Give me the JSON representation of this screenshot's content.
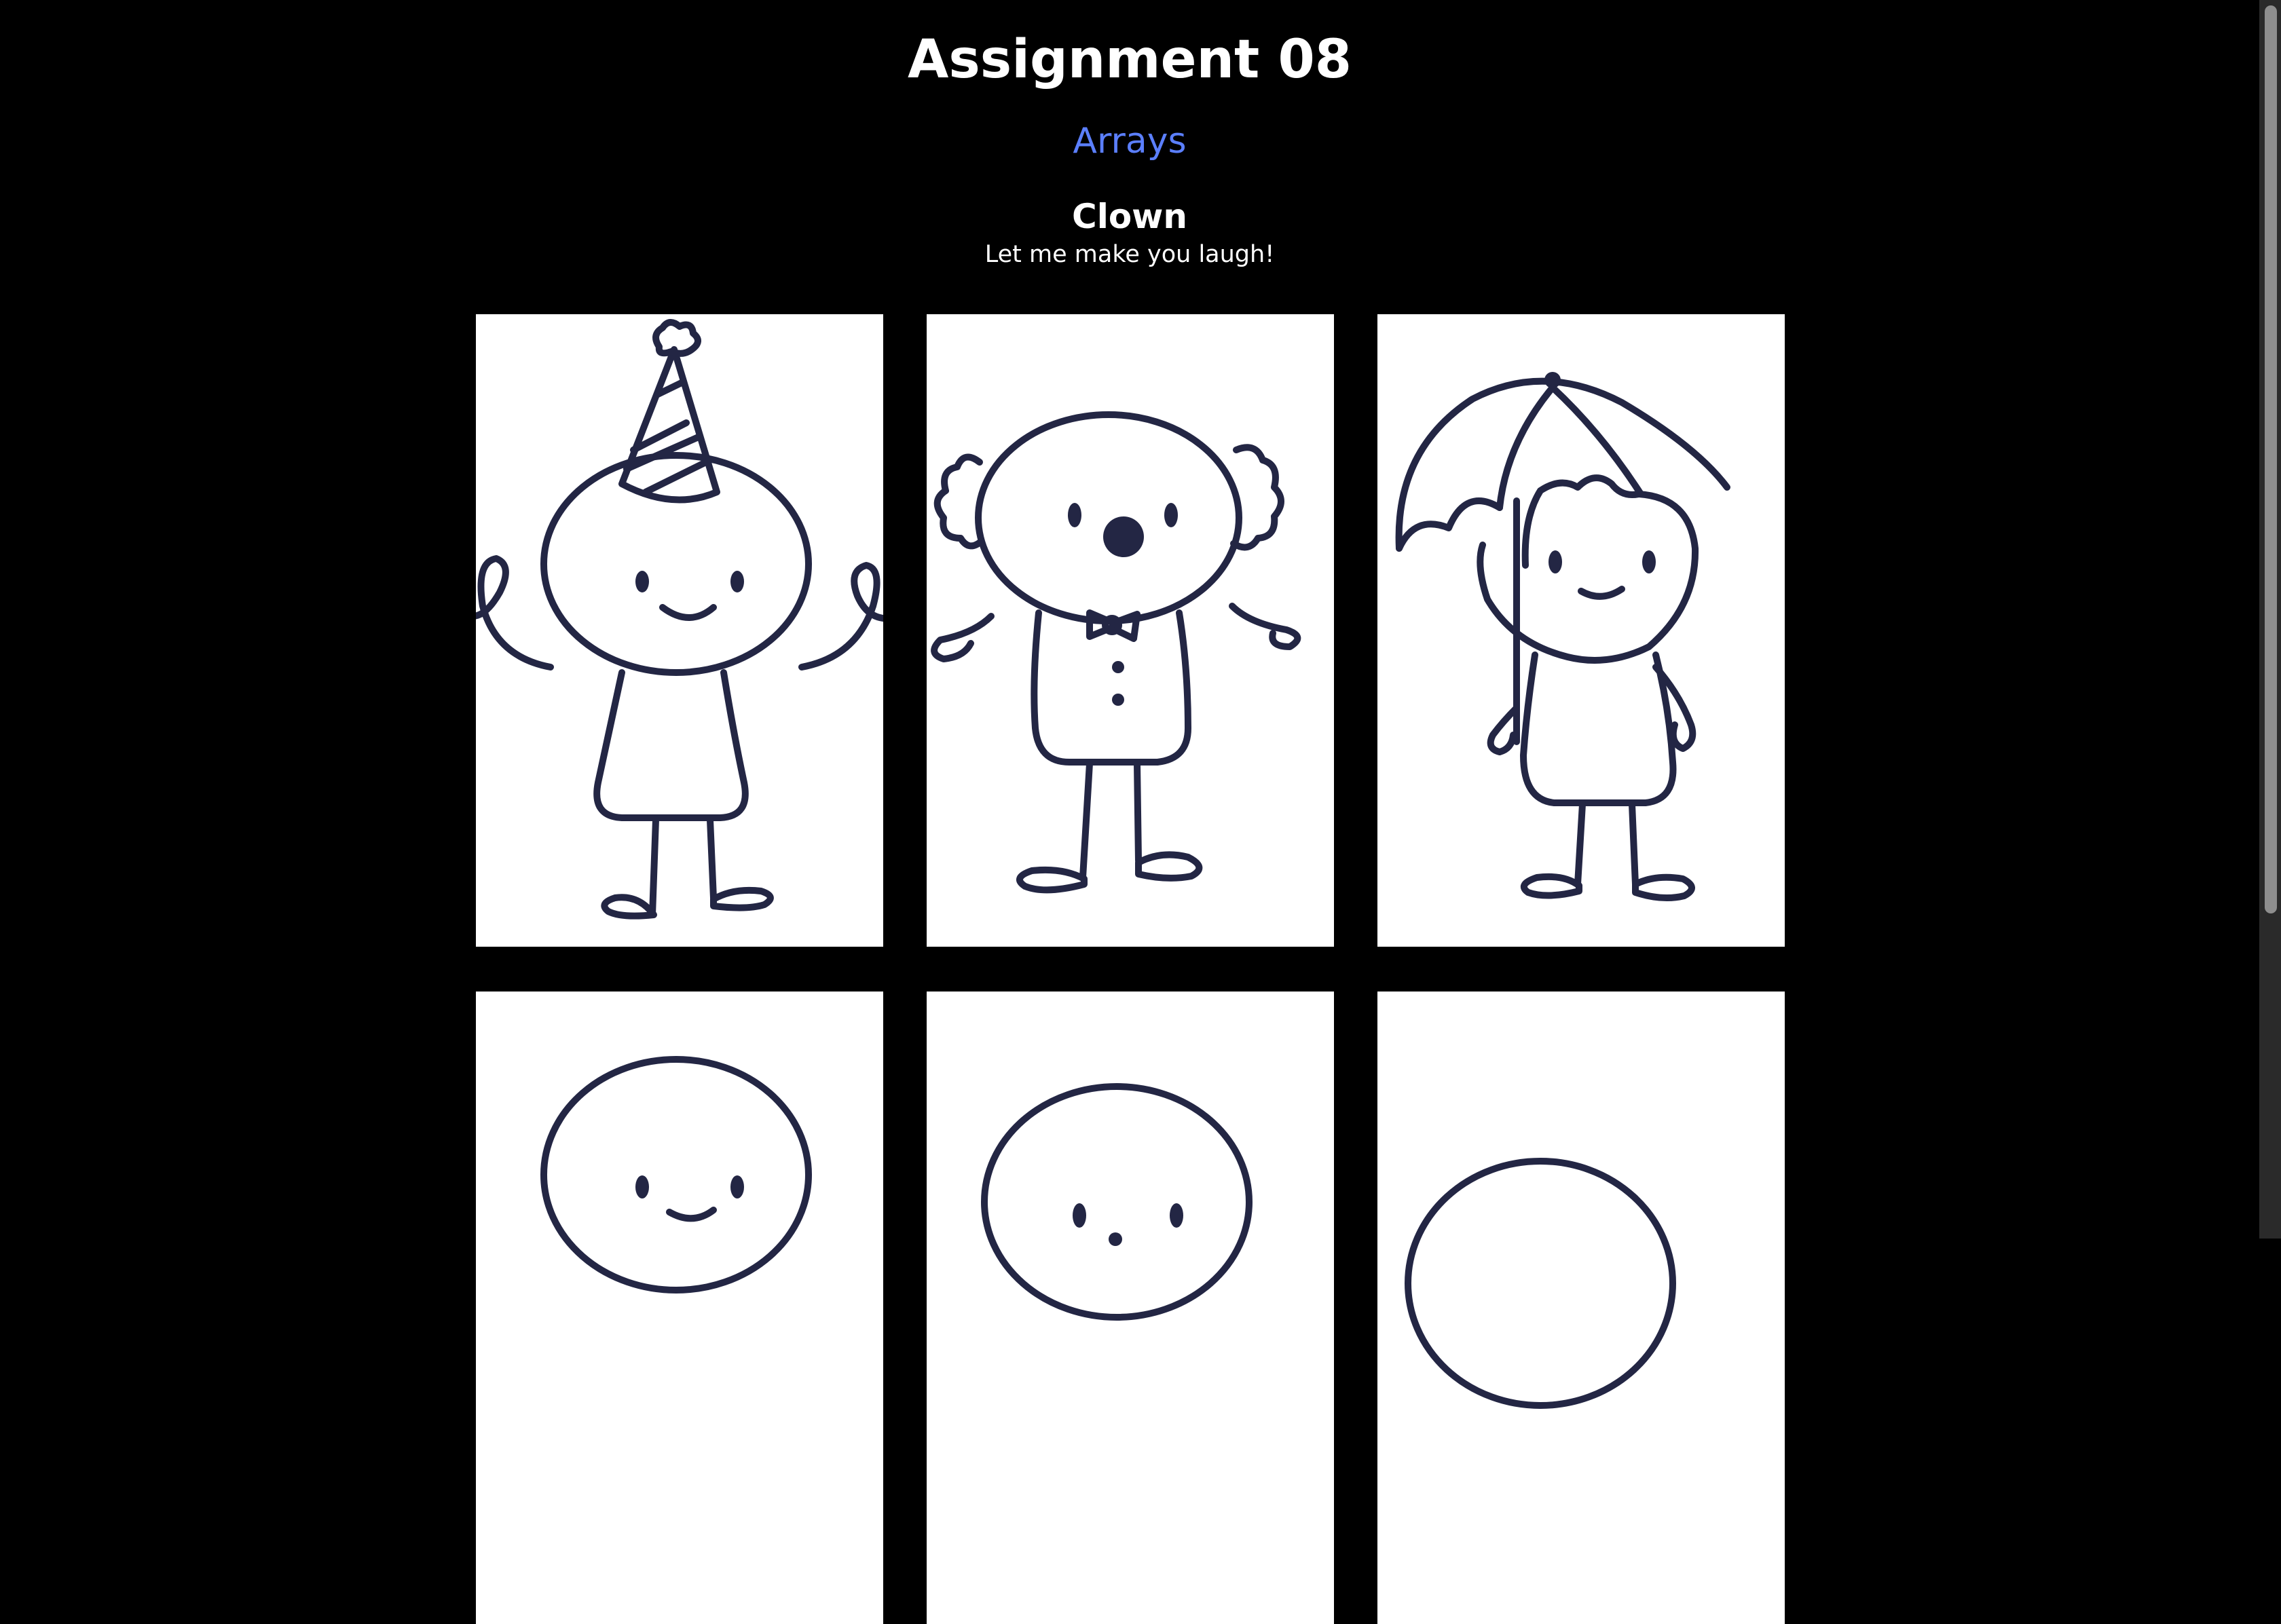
{
  "header": {
    "title": "Assignment 08",
    "subtitle": "Arrays",
    "clown_name": "Clown",
    "tagline": "Let me make you laugh!"
  },
  "colors": {
    "background": "#000000",
    "link": "#5b7fff",
    "ink": "#232644",
    "card": "#ffffff"
  },
  "gallery": {
    "items": [
      {
        "icon": "clown-party-hat-icon"
      },
      {
        "icon": "clown-bowtie-icon"
      },
      {
        "icon": "clown-umbrella-icon"
      },
      {
        "icon": "clown-smile-icon"
      },
      {
        "icon": "clown-face-icon"
      },
      {
        "icon": "clown-head-icon"
      }
    ]
  }
}
